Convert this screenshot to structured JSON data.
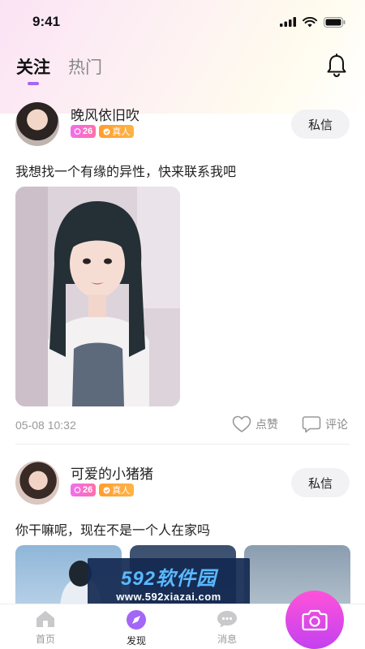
{
  "status_bar": {
    "time": "9:41"
  },
  "header": {
    "tabs": [
      {
        "label": "关注",
        "active": true
      },
      {
        "label": "热门",
        "active": false
      }
    ],
    "notification_icon": "bell-icon"
  },
  "posts": [
    {
      "username": "晚风依旧吹",
      "age": "26",
      "verified_label": "真人",
      "dm_label": "私信",
      "text": "我想找一个有缘的异性，快来联系我吧",
      "time": "05-08 10:32",
      "like_label": "点赞",
      "comment_label": "评论"
    },
    {
      "username": "可爱的小猪猪",
      "age": "26",
      "verified_label": "真人",
      "dm_label": "私信",
      "text": "你干嘛呢，现在不是一个人在家吗"
    }
  ],
  "watermark": {
    "brand": "592软件园",
    "url": "www.592xiazai.com"
  },
  "tabbar": {
    "items": [
      {
        "label": "首页",
        "icon": "home-icon",
        "active": false
      },
      {
        "label": "发现",
        "icon": "discover-icon",
        "active": true
      },
      {
        "label": "消息",
        "icon": "message-icon",
        "active": false
      }
    ],
    "camera_icon": "camera-icon"
  },
  "colors": {
    "accent_purple": "#a366f6",
    "age_badge": "#f06ef0",
    "verified_badge": "#ff9d2e",
    "camera_button": "#e04be6"
  }
}
